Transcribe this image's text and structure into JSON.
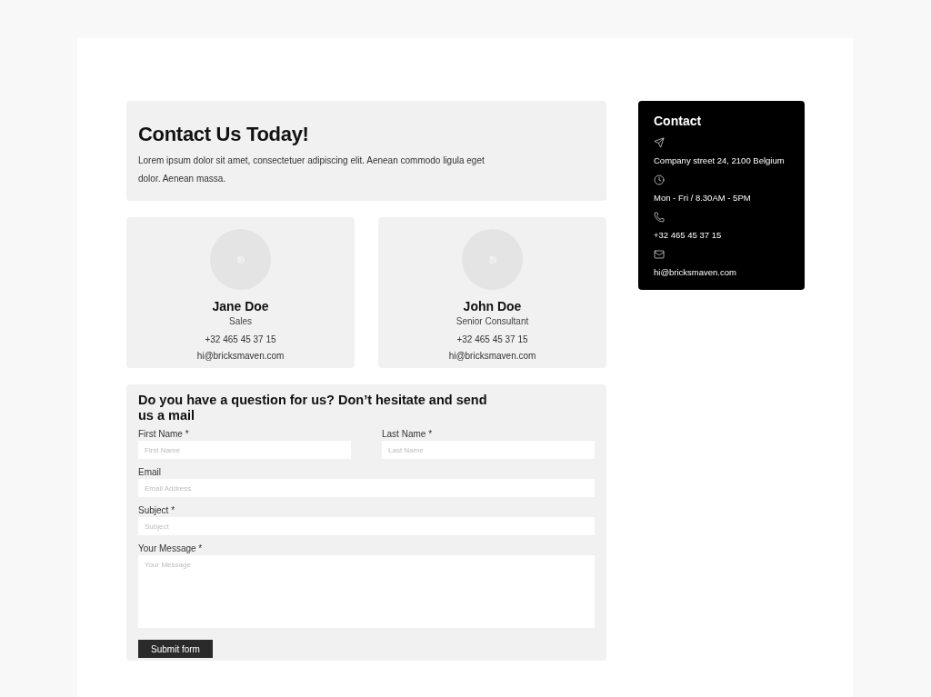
{
  "intro": {
    "title": "Contact Us Today!",
    "text": "Lorem ipsum dolor sit amet, consectetuer adipiscing elit. Aenean commodo ligula eget dolor. Aenean massa."
  },
  "people": [
    {
      "name": "Jane Doe",
      "role": "Sales",
      "phone": "+32 465 45 37 15",
      "email": "hi@bricksmaven.com"
    },
    {
      "name": "John Doe",
      "role": "Senior Consultant",
      "phone": "+32 465 45 37 15",
      "email": "hi@bricksmaven.com"
    }
  ],
  "form": {
    "title": "Do you have a question for us? Don’t hesitate and send us a mail",
    "fields": [
      {
        "kind": "input",
        "half": true,
        "label": "First Name *",
        "placeholder": "First Name"
      },
      {
        "kind": "input",
        "half": true,
        "label": "Last Name *",
        "placeholder": "Last Name"
      },
      {
        "kind": "input",
        "half": false,
        "label": "Email",
        "placeholder": "Email Address"
      },
      {
        "kind": "input",
        "half": false,
        "label": "Subject *",
        "placeholder": "Subject"
      },
      {
        "kind": "textarea",
        "half": false,
        "label": "Your Message *",
        "placeholder": "Your Message"
      }
    ],
    "submit": "Submit form"
  },
  "contact": {
    "title": "Contact",
    "items": [
      {
        "kind": "address",
        "text": "Company street 24, 2100 Belgium"
      },
      {
        "kind": "hours",
        "text": "Mon - Fri / 8.30AM - 5PM"
      },
      {
        "kind": "phone",
        "text": "+32 465 45 37 15"
      },
      {
        "kind": "email",
        "text": "hi@bricksmaven.com"
      }
    ]
  }
}
